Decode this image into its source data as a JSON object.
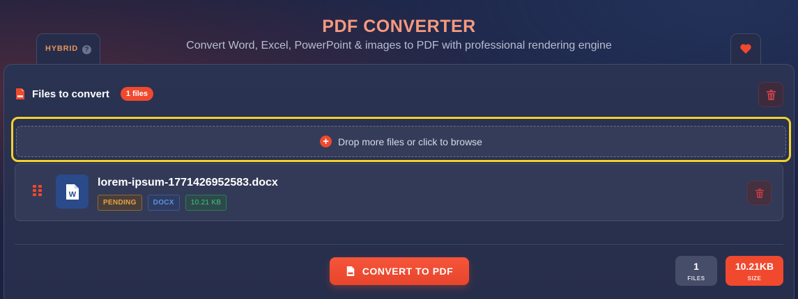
{
  "header": {
    "title": "PDF CONVERTER",
    "subtitle": "Convert Word, Excel, PowerPoint & images to PDF with professional rendering engine"
  },
  "mode_tab": {
    "label": "HYBRID",
    "help": "?"
  },
  "files_section": {
    "title": "Files to convert",
    "count_badge": "1 files"
  },
  "dropzone": {
    "text": "Drop more files or click to browse",
    "icon": "+"
  },
  "files": [
    {
      "name": "lorem-ipsum-1771426952583.docx",
      "icon_letter": "W",
      "status": "PENDING",
      "type": "DOCX",
      "size": "10.21 KB"
    }
  ],
  "actions": {
    "convert_label": "CONVERT TO PDF"
  },
  "stats": {
    "files_value": "1",
    "files_label": "FILES",
    "size_value": "10.21KB",
    "size_label": "SIZE"
  },
  "colors": {
    "accent": "#f0492e",
    "title": "#f79a7e",
    "highlight": "#f2d22e",
    "word_blue": "#2a4a8a"
  }
}
